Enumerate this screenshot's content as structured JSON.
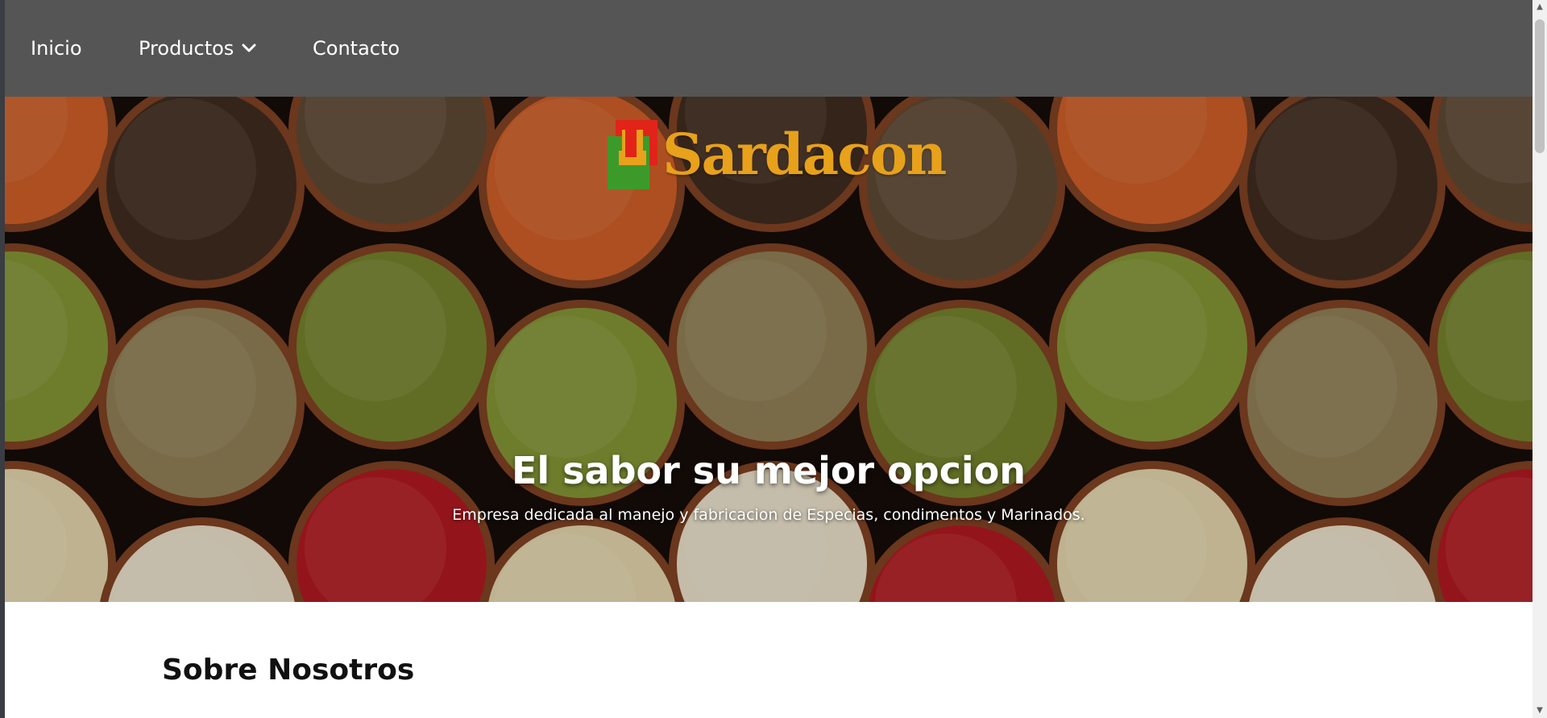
{
  "nav": {
    "items": [
      {
        "label": "Inicio"
      },
      {
        "label": "Productos"
      },
      {
        "label": "Contacto"
      }
    ],
    "background": "#555555"
  },
  "hero": {
    "logo_text": "Sardacon",
    "title": "El sabor su mejor opcion",
    "subtitle": "Empresa dedicada al manejo y fabricacion de Especias, condimentos y Marinados."
  },
  "section": {
    "title": "Sobre Nosotros"
  },
  "icons": {
    "chevron": "chevron-down-icon",
    "logo_mark": "sardacon-logo-mark"
  },
  "colors": {
    "logo_orange": "#e8a11a",
    "logo_red": "#e2231a",
    "logo_green": "#3c9a2a"
  }
}
